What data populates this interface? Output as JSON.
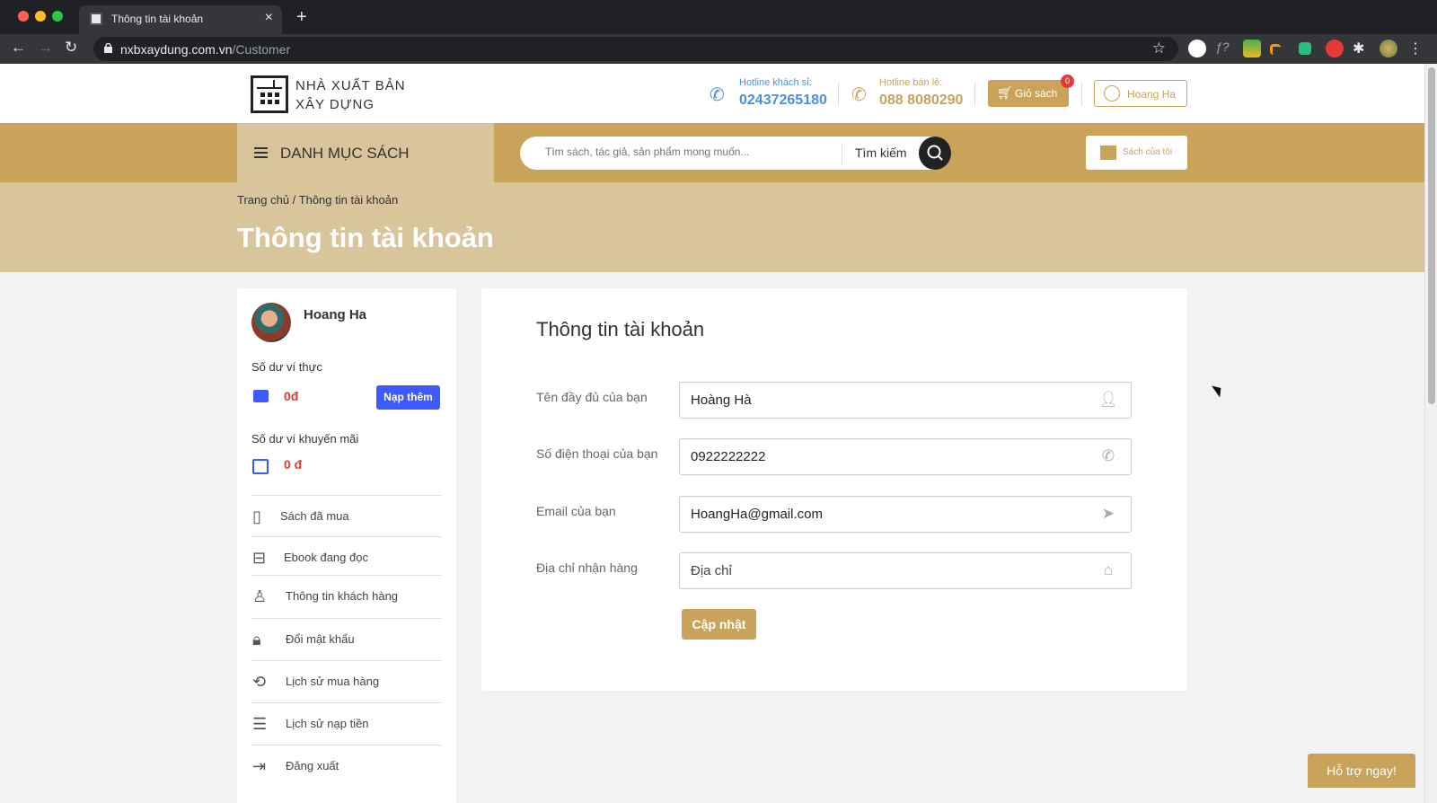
{
  "browser": {
    "tab_title": "Thông tin tài khoản",
    "new_tab": "+",
    "tab_close": "×",
    "url_domain": "nxbxaydung.com.vn",
    "url_path": "/Customer"
  },
  "header": {
    "logo_line1": "NHÀ XUẤT BẢN",
    "logo_line2": "XÂY DỰNG",
    "hotline_wholesale_label": "Hotline khách sỉ:",
    "hotline_wholesale_number": "02437265180",
    "hotline_retail_label": "Hotline bán lẻ:",
    "hotline_retail_number": "088 8080290",
    "cart_label": "Giỏ sách",
    "cart_count": "0",
    "user_label": "Hoang Ha"
  },
  "navbar": {
    "category_label": "DANH MỤC SÁCH",
    "search_placeholder": "Tìm sách, tác giả, sản phẩm mong muốn...",
    "search_label": "Tìm kiếm",
    "my_books_label": "Sách của tôi"
  },
  "banner": {
    "breadcrumb": "Trang chủ / Thông tin tài khoản",
    "title": "Thông tin tài khoản"
  },
  "sidebar": {
    "user_name": "Hoang Ha",
    "real_wallet_label": "Số dư ví thực",
    "real_wallet_value": "0đ",
    "topup_label": "Nạp thêm",
    "promo_wallet_label": "Số dư ví khuyến mãi",
    "promo_wallet_value": "0 đ",
    "items": [
      {
        "label": "Sách đã mua",
        "icon": "book-icon"
      },
      {
        "label": "Ebook đang đọc",
        "icon": "open-book-icon"
      },
      {
        "label": "Thông tin khách hàng",
        "icon": "user-icon"
      },
      {
        "label": "Đổi mật khẩu",
        "icon": "lock-icon"
      },
      {
        "label": "Lịch sử mua hàng",
        "icon": "history-icon"
      },
      {
        "label": "Lịch sử nạp tiền",
        "icon": "coins-icon"
      },
      {
        "label": "Đăng xuất",
        "icon": "logout-icon"
      }
    ]
  },
  "form": {
    "title": "Thông tin tài khoản",
    "fullname_label": "Tên đầy đủ của bạn",
    "fullname_value": "Hoàng Hà",
    "phone_label": "Số điện thoại của bạn",
    "phone_value": "0922222222",
    "email_label": "Email của bạn",
    "email_value": "HoangHa@gmail.com",
    "address_label": "Địa chỉ nhận hàng",
    "address_placeholder": "Địa chỉ",
    "update_label": "Cập nhật"
  },
  "support_label": "Hỗ trợ ngay!",
  "colors": {
    "accent_gold": "#c9a35a",
    "banner_gold": "#d9c59c",
    "button_blue": "#3d5afe",
    "money_red": "#e53935",
    "hotline_blue": "#4a90e2"
  }
}
